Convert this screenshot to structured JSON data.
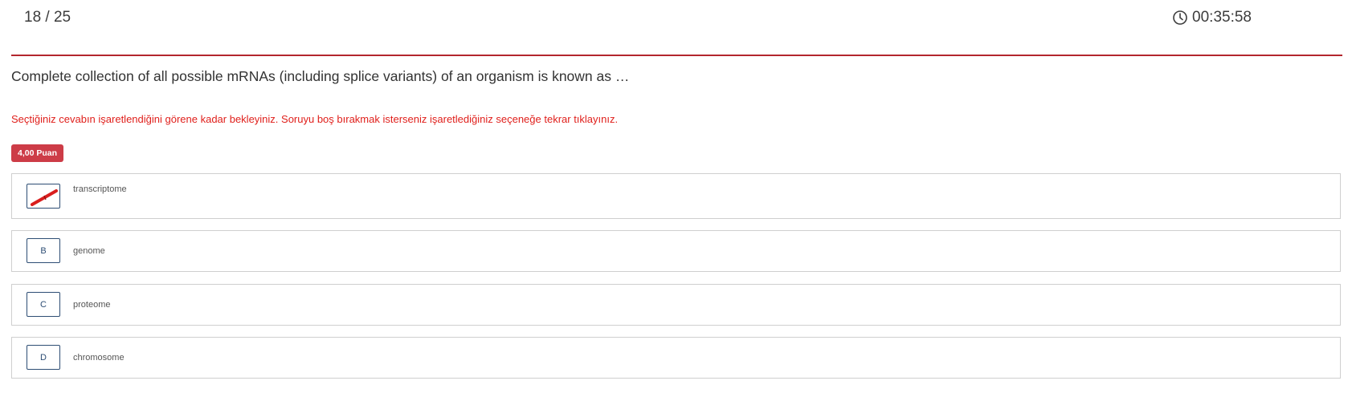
{
  "header": {
    "question_counter": "18 / 25",
    "timer": "00:35:58",
    "timer_icon": "clock-icon"
  },
  "question": {
    "text": "Complete collection of all possible mRNAs (including splice variants) of an organism is known as …",
    "warning": "Seçtiğiniz cevabın işaretlendiğini görene kadar bekleyiniz. Soruyu boş bırakmak isterseniz işaretlediğiniz seçeneğe tekrar tıklayınız.",
    "points_label": "4,00 Puan"
  },
  "options": [
    {
      "letter": "A",
      "text": "transcriptome",
      "eliminated": true
    },
    {
      "letter": "B",
      "text": "genome",
      "eliminated": false
    },
    {
      "letter": "C",
      "text": "proteome",
      "eliminated": false
    },
    {
      "letter": "D",
      "text": "chromosome",
      "eliminated": false
    }
  ],
  "colors": {
    "accent_red": "#b3262d",
    "warning_red": "#e0201c",
    "badge_red": "#cd3c47",
    "option_border_blue": "#2d4d74",
    "strike_red": "#d91e1e"
  }
}
